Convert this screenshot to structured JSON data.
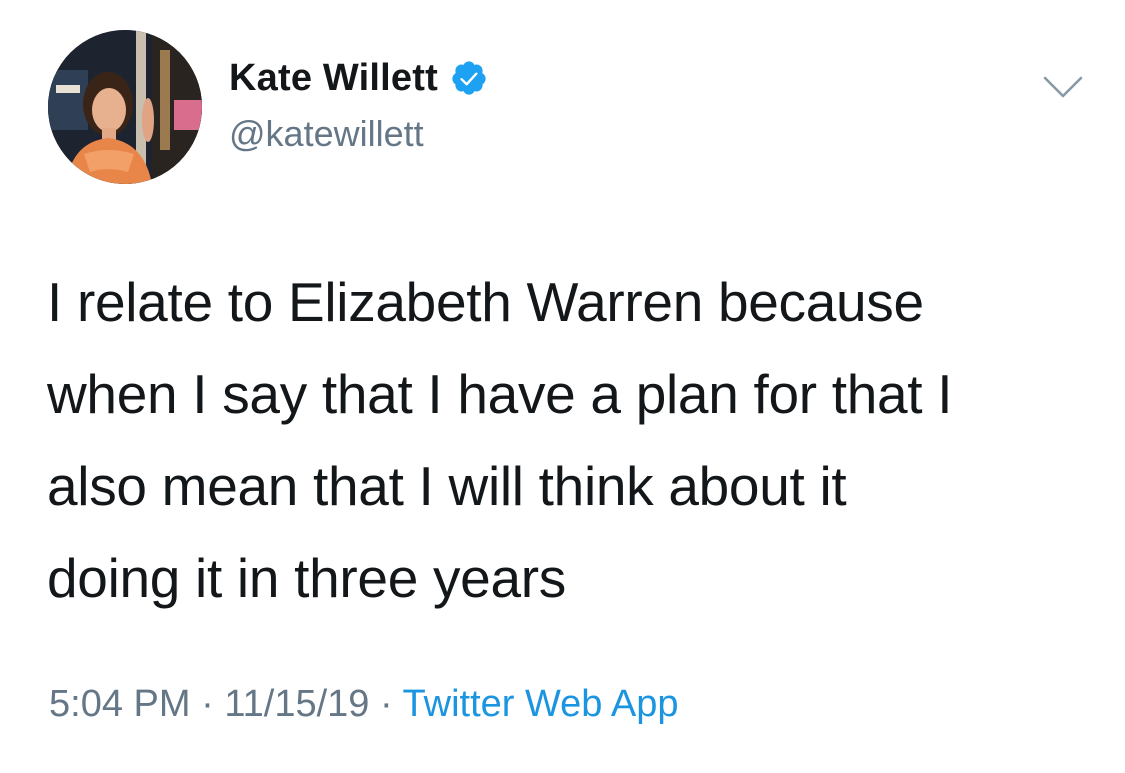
{
  "author": {
    "display_name": "Kate Willett",
    "handle": "@katewillett",
    "verified": true,
    "avatar_icon": "profile-photo"
  },
  "tweet": {
    "lines": [
      "I relate to Elizabeth Warren because",
      "when I say that I have a plan for that I",
      "also mean that I will think about it",
      "doing it in three years"
    ]
  },
  "meta": {
    "time": "5:04 PM",
    "separator": "·",
    "date": "11/15/19",
    "source": "Twitter Web App"
  },
  "colors": {
    "text": "#14171a",
    "secondary": "#657786",
    "link": "#1b95e0",
    "verified_badge": "#1da1f2"
  },
  "icons": {
    "verified": "verified-badge-icon",
    "menu": "chevron-down-icon"
  }
}
